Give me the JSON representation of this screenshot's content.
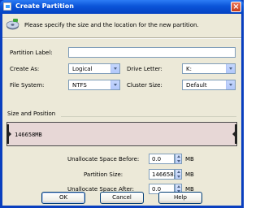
{
  "window": {
    "title": "Create Partition"
  },
  "header": {
    "text": "Please specify the size and the location for the new partition."
  },
  "form": {
    "partition_label": {
      "label": "Partition Label:",
      "value": ""
    },
    "create_as": {
      "label": "Create As:",
      "value": "Logical"
    },
    "drive_letter": {
      "label": "Drive Letter:",
      "value": "K:"
    },
    "file_system": {
      "label": "File System:",
      "value": "NTFS"
    },
    "cluster_size": {
      "label": "Cluster Size:",
      "value": "Default"
    }
  },
  "size_position": {
    "group_label": "Size and Position",
    "bar_size_text": "146658MB",
    "before": {
      "label": "Unallocate Space Before:",
      "value": "0.0",
      "unit": "MB"
    },
    "size": {
      "label": "Partition Size:",
      "value": "146658.4",
      "unit": "MB"
    },
    "after": {
      "label": "Unallocate Space After:",
      "value": "0.0",
      "unit": "MB"
    }
  },
  "buttons": {
    "ok": "OK",
    "cancel": "Cancel",
    "help": "Help"
  },
  "colors": {
    "titlebar": "#0b54d8",
    "dialog_bg": "#ece9d8",
    "partition_fill": "#e7d7d6"
  },
  "icons": {
    "title": "window-icon",
    "header": "disk-wizard-icon",
    "close": "close-icon"
  }
}
